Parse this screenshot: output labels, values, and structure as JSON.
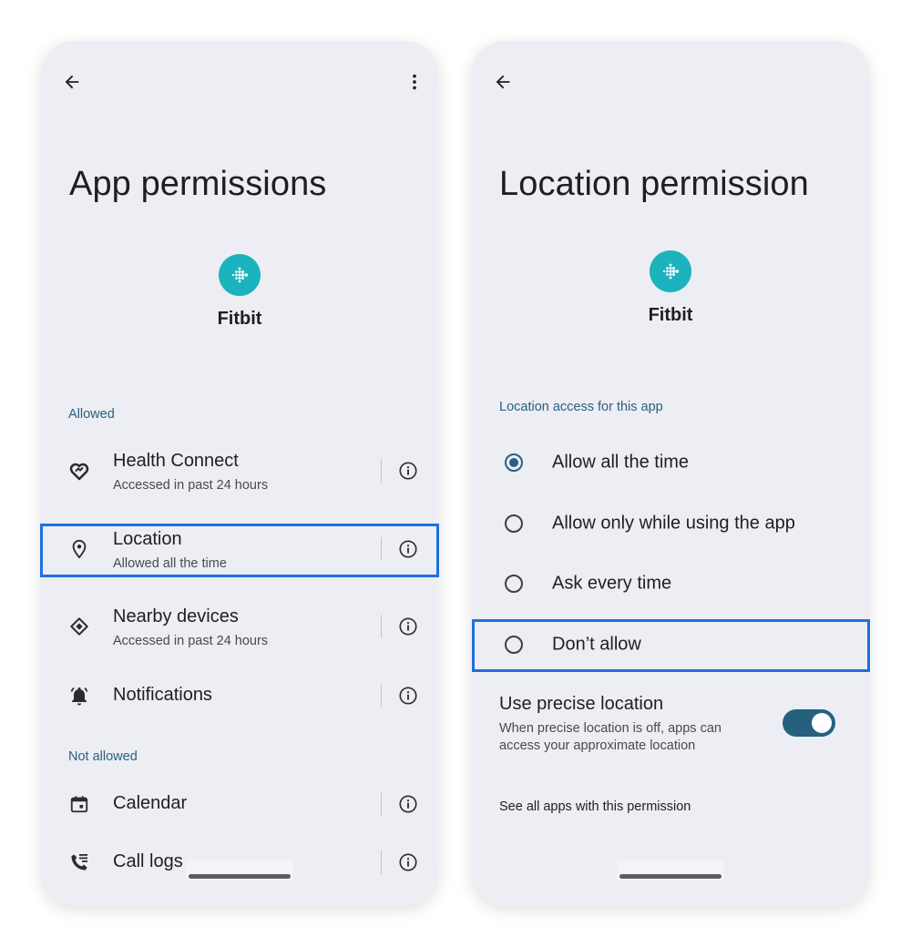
{
  "colors": {
    "phone_bg": "#eceef3",
    "accent": "#2b5f7f",
    "toggle_on": "#25607f",
    "highlight": "#1f6fe0",
    "logo_bg": "#1bb3bd"
  },
  "left_screen": {
    "back_icon": "arrow-left-icon",
    "menu_icon": "more-vert-icon",
    "title": "App permissions",
    "app": {
      "logo_icon": "fitbit-logo-icon",
      "name": "Fitbit"
    },
    "allowed_label": "Allowed",
    "allowed": [
      {
        "icon": "health-connect-icon",
        "title": "Health Connect",
        "subtitle": "Accessed in past 24 hours"
      },
      {
        "icon": "location-pin-icon",
        "title": "Location",
        "subtitle": "Allowed all the time",
        "highlighted": true
      },
      {
        "icon": "nearby-devices-icon",
        "title": "Nearby devices",
        "subtitle": "Accessed in past 24 hours"
      },
      {
        "icon": "notifications-bell-icon",
        "title": "Notifications"
      }
    ],
    "not_allowed_label": "Not allowed",
    "not_allowed": [
      {
        "icon": "calendar-icon",
        "title": "Calendar"
      },
      {
        "icon": "call-log-icon",
        "title": "Call logs"
      }
    ],
    "info_icon": "info-icon"
  },
  "right_screen": {
    "back_icon": "arrow-left-icon",
    "title": "Location permission",
    "app": {
      "logo_icon": "fitbit-logo-icon",
      "name": "Fitbit"
    },
    "section_label": "Location access for this app",
    "options": [
      {
        "label": "Allow all the time",
        "selected": true
      },
      {
        "label": "Allow only while using the app",
        "selected": false
      },
      {
        "label": "Ask every time",
        "selected": false
      },
      {
        "label": "Don’t allow",
        "selected": false,
        "highlighted": true
      }
    ],
    "precise": {
      "title": "Use precise location",
      "description_line1": "When precise location is off, apps can",
      "description_line2": "access your approximate location",
      "enabled": true
    },
    "see_all": "See all apps with this permission"
  }
}
